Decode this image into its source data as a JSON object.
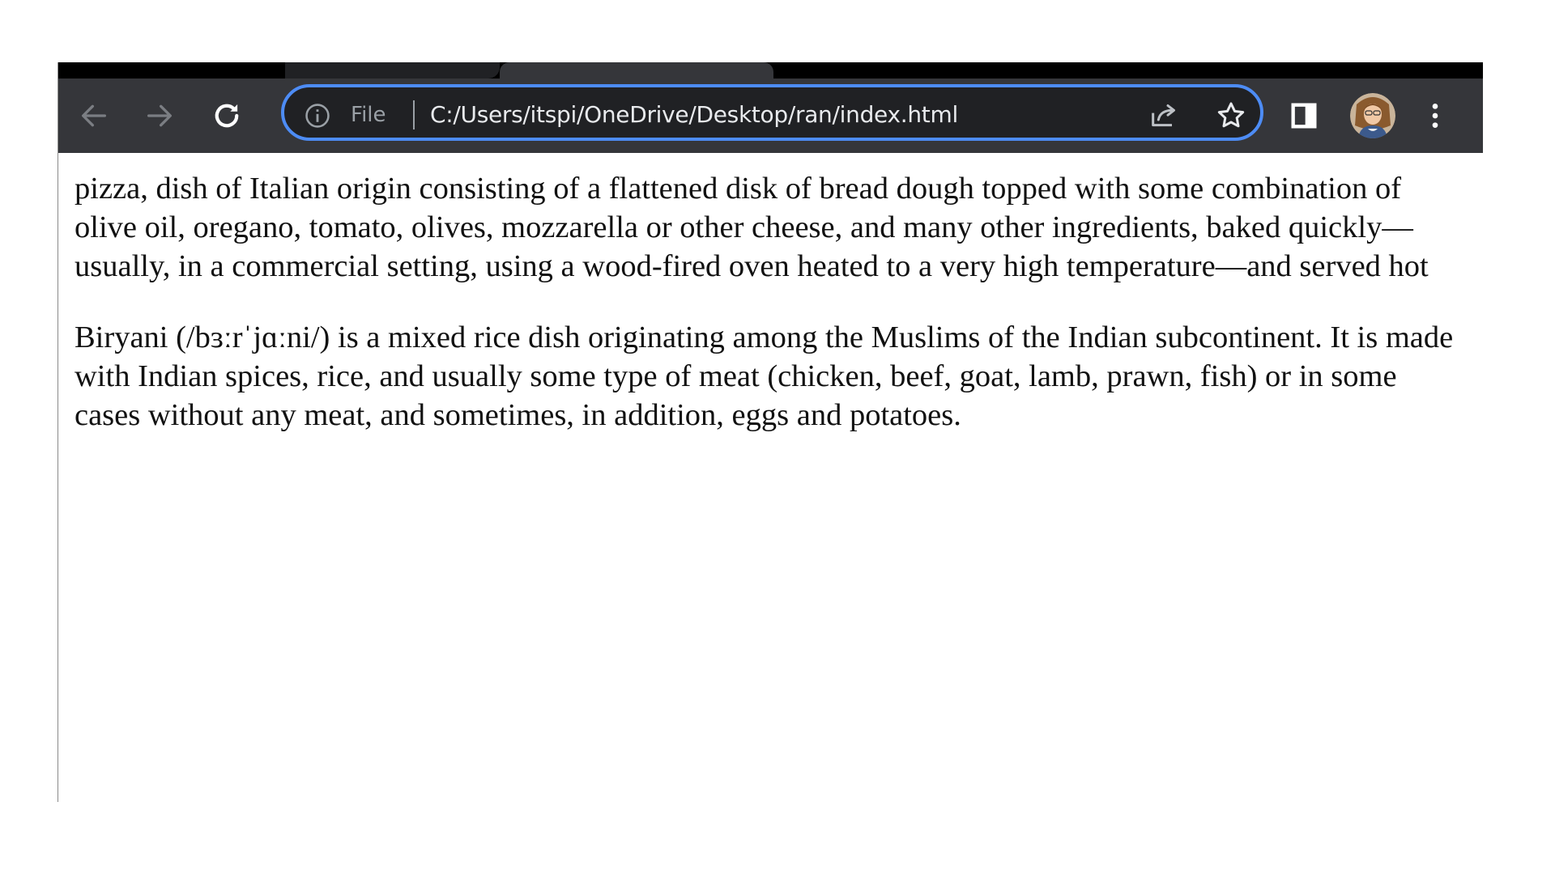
{
  "browser": {
    "address_bar": {
      "scheme_label": "File",
      "url": "C:/Users/itspi/OneDrive/Desktop/ran/index.html"
    }
  },
  "icons": {
    "back": "arrow-left-icon",
    "forward": "arrow-right-icon",
    "reload": "reload-icon",
    "site_info": "info-icon",
    "share": "share-icon",
    "bookmark": "star-icon",
    "side_panel": "side-panel-icon",
    "profile": "avatar",
    "menu": "kebab-menu-icon"
  },
  "colors": {
    "toolbar_bg": "#35363a",
    "omnibox_bg": "#202124",
    "omnibox_focus_ring": "#4d8cf5",
    "url_text": "#e8eaed",
    "muted_text": "#9aa0a6",
    "page_text": "#111111"
  },
  "page": {
    "paragraphs": [
      "pizza, dish of Italian origin consisting of a flattened disk of bread dough topped with some combination of olive oil, oregano, tomato, olives, mozzarella or other cheese, and many other ingredients, baked quickly—usually, in a commercial setting, using a wood-fired oven heated to a very high temperature—and served hot",
      "Biryani (/bɜːrˈjɑːni/) is a mixed rice dish originating among the Muslims of the Indian subcontinent. It is made with Indian spices, rice, and usually some type of meat (chicken, beef, goat, lamb, prawn, fish) or in some cases without any meat, and sometimes, in addition, eggs and potatoes."
    ]
  }
}
